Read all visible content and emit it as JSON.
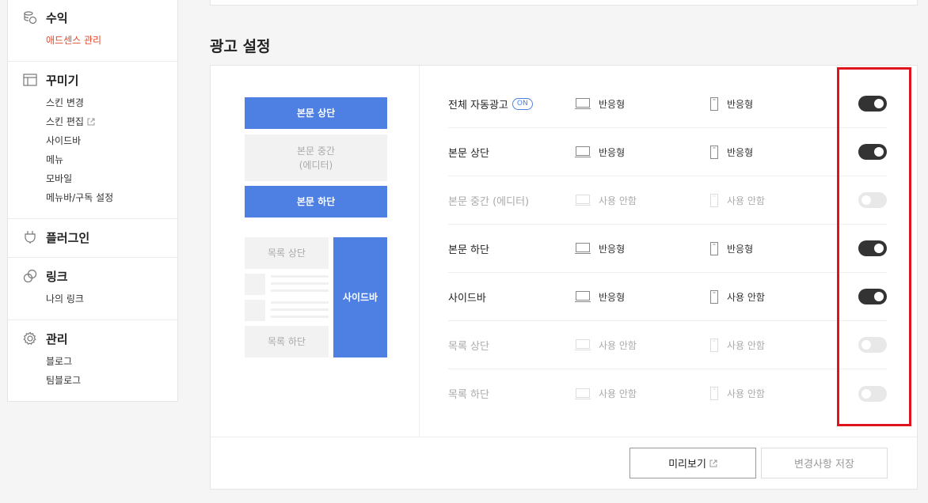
{
  "sidebar": {
    "sections": [
      {
        "title": "수익",
        "icon": "coins-icon",
        "items": [
          {
            "label": "애드센스 관리",
            "active": true
          }
        ]
      },
      {
        "title": "꾸미기",
        "icon": "layout-icon",
        "items": [
          {
            "label": "스킨 변경"
          },
          {
            "label": "스킨 편집",
            "external": true
          },
          {
            "label": "사이드바"
          },
          {
            "label": "메뉴"
          },
          {
            "label": "모바일"
          },
          {
            "label": "메뉴바/구독 설정"
          }
        ]
      },
      {
        "title": "플러그인",
        "icon": "plug-icon",
        "items": []
      },
      {
        "title": "링크",
        "icon": "link-icon",
        "items": [
          {
            "label": "나의 링크"
          }
        ]
      },
      {
        "title": "관리",
        "icon": "gear-icon",
        "items": [
          {
            "label": "블로그"
          },
          {
            "label": "팀블로그"
          }
        ]
      }
    ]
  },
  "ad_settings": {
    "title": "광고 설정",
    "preview": {
      "top": "본문 상단",
      "middle": "본문 중간\n(에디터)",
      "bottom": "본문 하단",
      "list_top": "목록 상단",
      "list_bottom": "목록 하단",
      "sidebar": "사이드바"
    },
    "rows": [
      {
        "label": "전체 자동광고",
        "badge": "ON",
        "pc": "반응형",
        "mobile": "반응형",
        "enabled": true
      },
      {
        "label": "본문 상단",
        "pc": "반응형",
        "mobile": "반응형",
        "enabled": true
      },
      {
        "label": "본문 중간 (에디터)",
        "pc": "사용 안함",
        "mobile": "사용 안함",
        "enabled": false
      },
      {
        "label": "본문 하단",
        "pc": "반응형",
        "mobile": "반응형",
        "enabled": true
      },
      {
        "label": "사이드바",
        "pc": "반응형",
        "mobile": "사용 안함",
        "enabled": true
      },
      {
        "label": "목록 상단",
        "pc": "사용 안함",
        "mobile": "사용 안함",
        "enabled": false
      },
      {
        "label": "목록 하단",
        "pc": "사용 안함",
        "mobile": "사용 안함",
        "enabled": false
      }
    ],
    "preview_button": "미리보기",
    "save_button": "변경사항 저장"
  },
  "colors": {
    "accent": "#4e7fe2",
    "active_link": "#e0492c",
    "highlight": "#e0141e",
    "toggle_on": "#333333"
  }
}
